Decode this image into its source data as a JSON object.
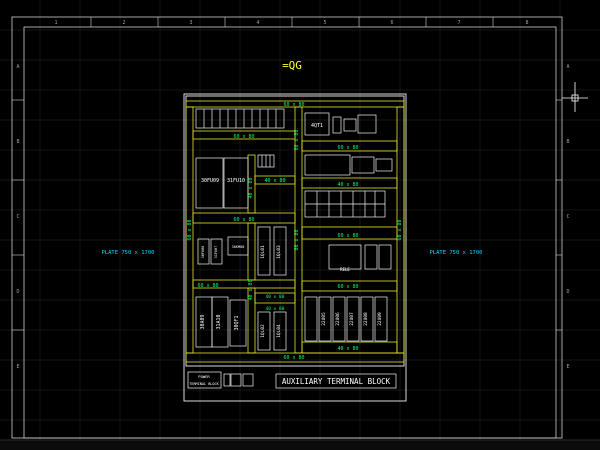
{
  "title": "=QG",
  "plate_left": "PLATE 750 x 1700",
  "plate_right": "PLATE 750 x 1700",
  "col_numbers": [
    "1",
    "2",
    "3",
    "4",
    "5",
    "6",
    "7",
    "8"
  ],
  "row_letters": [
    "A",
    "B",
    "C",
    "D",
    "E"
  ],
  "ducts": {
    "d1": "60 x 80",
    "d2": "60 x 80",
    "d3": "60 x 80",
    "d4": "60 x 80",
    "d5": "60 x 80",
    "d6": "60 x 80",
    "d7": "60 x 80",
    "d8": "60 x 80",
    "d9": "40 x 80",
    "d10": "40 x 80",
    "d11": "40 x 80",
    "d12": "40 x 80",
    "d13": "40 x 80",
    "d14": "60 x 80",
    "d15": "60 x 80",
    "d16": "60 x 80",
    "d17": "60 x 80",
    "d18": "40 x 80",
    "d19": "40 x 80"
  },
  "components": {
    "c1": "4QT1",
    "c2": "30FU09",
    "c3": "31FU10",
    "c4": "30FU06",
    "c5": "31FU07",
    "c6": "30KM08",
    "c7": "1QL01",
    "c8": "1QL03",
    "c9": "30A09",
    "c10": "31A10",
    "c11": "30QF1",
    "c12": "1QL02",
    "c13": "1QL04",
    "c14": "22U05",
    "c15": "22U06",
    "c16": "22U07",
    "c17": "22U08",
    "c18": "22U09",
    "c19": "RELE"
  },
  "bottom": {
    "power_line1": "POWER",
    "power_line2": "TERMINAL BLOCK",
    "aux": "AUXILIARY TERMINAL BLOCK"
  }
}
